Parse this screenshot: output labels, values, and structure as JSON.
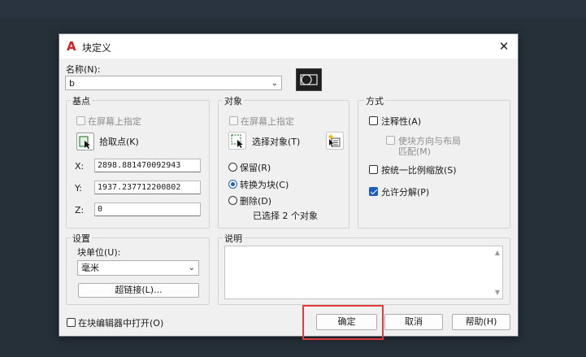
{
  "window": {
    "title": "块定义",
    "close_glyph": "✕",
    "app_icon": "autocad-a-icon"
  },
  "name": {
    "label": "名称(N):",
    "value": "b"
  },
  "base_point": {
    "title": "基点",
    "specify_on_screen": "在屏幕上指定",
    "pick_point": "拾取点(K)",
    "x_label": "X:",
    "x_value": "2898.881470092943",
    "y_label": "Y:",
    "y_value": "1937.237712200802",
    "z_label": "Z:",
    "z_value": "0"
  },
  "objects": {
    "title": "对象",
    "specify_on_screen": "在屏幕上指定",
    "select_objects": "选择对象(T)",
    "retain": "保留(R)",
    "convert_to_block": "转换为块(C)",
    "delete": "删除(D)",
    "selected_count": "已选择 2 个对象"
  },
  "behavior": {
    "title": "方式",
    "annotative": "注释性(A)",
    "match_orientation_line1": "使块方向与布局",
    "match_orientation_line2": "匹配(M)",
    "scale_uniformly": "按统一比例缩放(S)",
    "allow_exploding": "允许分解(P)"
  },
  "settings": {
    "title": "设置",
    "block_unit_label": "块单位(U):",
    "block_unit_value": "毫米",
    "hyperlink": "超链接(L)..."
  },
  "description": {
    "title": "说明"
  },
  "footer": {
    "open_in_editor": "在块编辑器中打开(O)",
    "ok": "确定",
    "cancel": "取消",
    "help": "帮助(H)"
  }
}
